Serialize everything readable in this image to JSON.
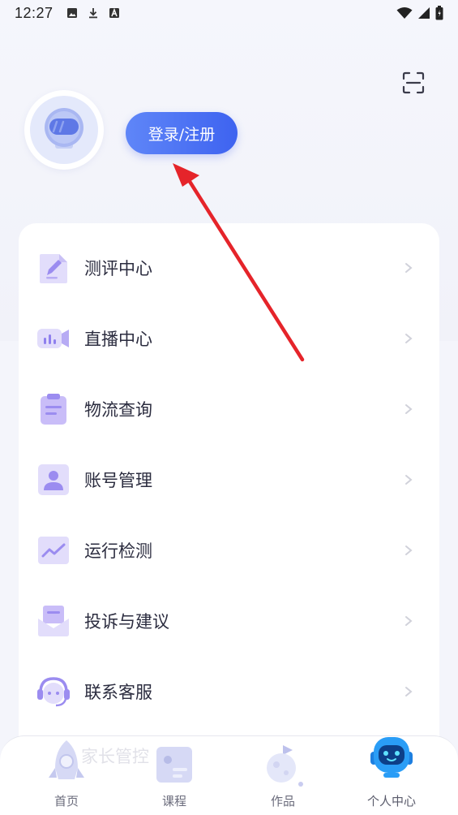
{
  "status_bar": {
    "time": "12:27"
  },
  "header": {
    "login_label": "登录/注册",
    "scan_icon": "scan-icon",
    "avatar_icon": "astronaut-helmet-icon"
  },
  "menu": {
    "items": [
      {
        "label": "测评中心",
        "icon": "assessment-icon"
      },
      {
        "label": "直播中心",
        "icon": "live-stream-icon"
      },
      {
        "label": "物流查询",
        "icon": "logistics-clipboard-icon"
      },
      {
        "label": "账号管理",
        "icon": "account-icon"
      },
      {
        "label": "运行检测",
        "icon": "monitor-chart-icon"
      },
      {
        "label": "投诉与建议",
        "icon": "mail-icon"
      },
      {
        "label": "联系客服",
        "icon": "headset-icon"
      }
    ],
    "faded_item": "家长管控"
  },
  "tab_bar": {
    "tabs": [
      {
        "label": "首页",
        "icon": "rocket-icon"
      },
      {
        "label": "课程",
        "icon": "course-icon"
      },
      {
        "label": "作品",
        "icon": "planet-icon"
      },
      {
        "label": "个人中心",
        "icon": "robot-icon",
        "active": true
      }
    ]
  },
  "colors": {
    "accent": "#4a6ef4",
    "icon_purple": "#9a8bf0",
    "annotation": "#e5242a"
  }
}
